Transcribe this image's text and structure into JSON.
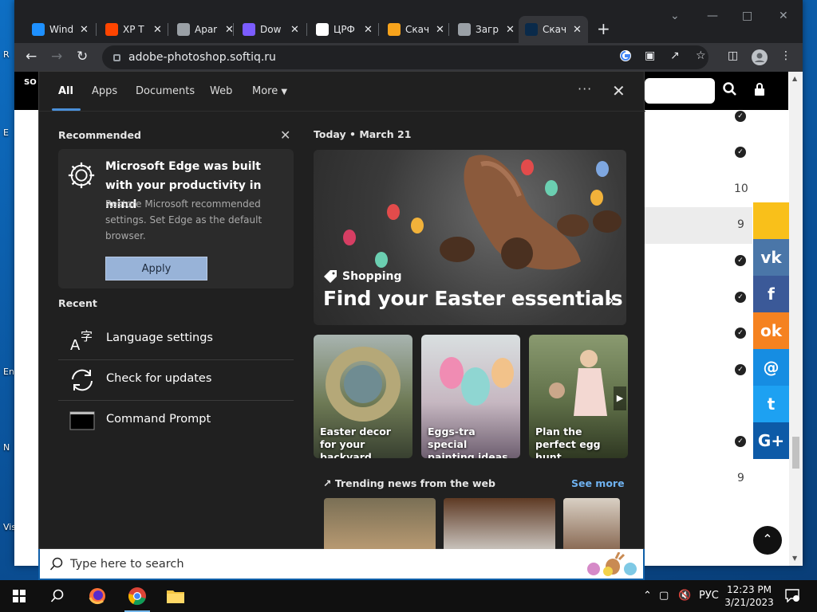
{
  "browser": {
    "tabs": [
      {
        "label": "Wind",
        "fav_color": "#1e90ff",
        "active": false
      },
      {
        "label": "XP T",
        "fav_color": "#ff4500",
        "active": false
      },
      {
        "label": "Apar",
        "fav_color": "#9aa0a6",
        "active": false
      },
      {
        "label": "Dow",
        "fav_color": "#7b5cff",
        "active": false
      },
      {
        "label": "ЦРФ",
        "fav_color": "#ffffff",
        "active": false
      },
      {
        "label": "Скач",
        "fav_color": "#f7a31c",
        "active": false
      },
      {
        "label": "Загр",
        "fav_color": "#9aa0a6",
        "active": false
      },
      {
        "label": "Скач",
        "fav_color": "#0a2a4a",
        "active": true
      }
    ],
    "url": "adobe-photoshop.softiq.ru"
  },
  "site": {
    "row_values": [
      "10",
      "9",
      "9"
    ],
    "social": [
      {
        "name": "yellow",
        "glyph": "",
        "color": "#f9c01a"
      },
      {
        "name": "vk",
        "glyph": "vk",
        "color": "#4a76a8"
      },
      {
        "name": "facebook",
        "glyph": "f",
        "color": "#3b5998"
      },
      {
        "name": "odnoklassniki",
        "glyph": "ok",
        "color": "#f58220"
      },
      {
        "name": "mail",
        "glyph": "@",
        "color": "#168de2"
      },
      {
        "name": "twitter",
        "glyph": "t",
        "color": "#1da1f2"
      },
      {
        "name": "google-plus",
        "glyph": "G+",
        "color": "#0d5aa7"
      }
    ]
  },
  "search_panel": {
    "tabs": [
      "All",
      "Apps",
      "Documents",
      "Web",
      "More"
    ],
    "recommended_title": "Recommended",
    "rec_card": {
      "heading": "Microsoft Edge was built with your productivity in mind",
      "body": "Restore Microsoft recommended settings. Set Edge as the default browser.",
      "button": "Apply"
    },
    "recent_title": "Recent",
    "recent": [
      "Language settings",
      "Check for updates",
      "Command Prompt"
    ],
    "today": "Today",
    "date": "March 21",
    "hero": {
      "tag": "Shopping",
      "title": "Find your Easter essentials"
    },
    "cards": [
      {
        "caption": "Easter decor for your backyard"
      },
      {
        "caption": "Eggs-tra special painting ideas"
      },
      {
        "caption": "Plan the perfect egg hunt"
      }
    ],
    "trending_title": "Trending news from the web",
    "see_more": "See more",
    "search_placeholder": "Type here to search"
  },
  "taskbar": {
    "language": "РУС",
    "time": "12:23 PM",
    "date": "3/21/2023"
  }
}
